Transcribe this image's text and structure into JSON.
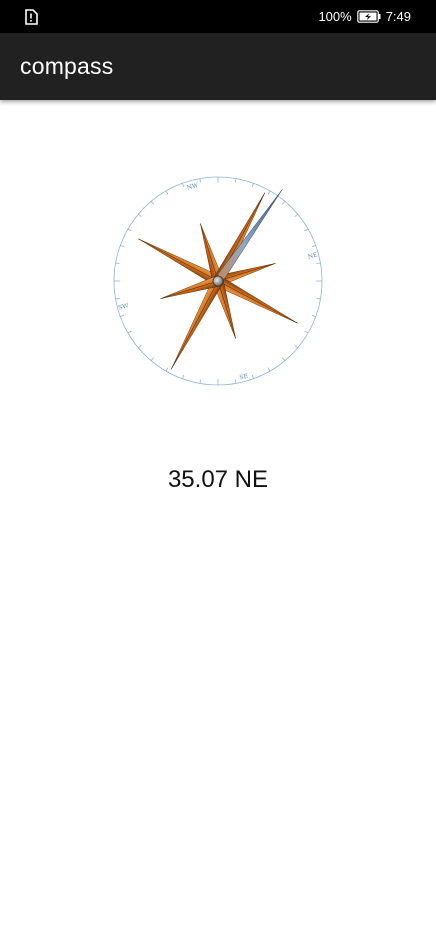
{
  "status_bar": {
    "left_icon": "sim-alert-icon",
    "battery_percent": "100%",
    "battery_icon": "battery-charging-icon",
    "time": "7:49"
  },
  "app_bar": {
    "title": "compass"
  },
  "compass": {
    "heading_degrees": 35.07,
    "labels": {
      "top": "NW",
      "right": "NE",
      "bottom": "SE",
      "left": "SW"
    },
    "needle_color": "#6f8fb8",
    "rose_color": "#d5731e",
    "ring_color": "#8fb4d8"
  },
  "readout": {
    "text": "35.07 NE"
  }
}
